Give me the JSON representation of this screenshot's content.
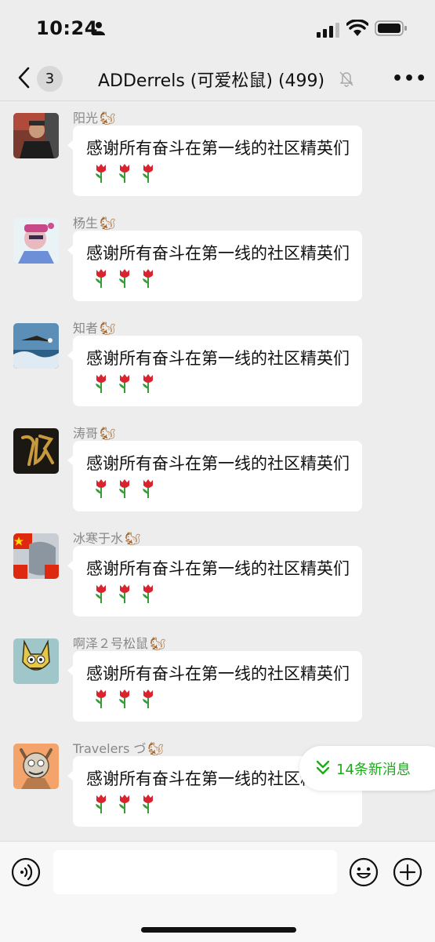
{
  "status": {
    "time": "10:24"
  },
  "nav": {
    "back_count": "3",
    "title": "ADDerrels (可爱松鼠) (499)"
  },
  "messages": [
    {
      "sender": "阳光",
      "text": "感谢所有奋斗在第一线的社区精英们",
      "avatar": "photo-man"
    },
    {
      "sender": "杨生",
      "text": "感谢所有奋斗在第一线的社区精英们",
      "avatar": "cartoon-pink"
    },
    {
      "sender": "知者",
      "text": "感谢所有奋斗在第一线的社区精英们",
      "avatar": "eagle-sea"
    },
    {
      "sender": "涛哥",
      "text": "感谢所有奋斗在第一线的社区精英们",
      "avatar": "gold-calligraphy"
    },
    {
      "sender": "冰寒于水",
      "text": "感谢所有奋斗在第一线的社区精英们",
      "avatar": "china-flag"
    },
    {
      "sender": "啊泽２号松鼠",
      "text": "感谢所有奋斗在第一线的社区精英们",
      "avatar": "cartoon-yellow-cat"
    },
    {
      "sender": "Travelers づ",
      "text": "感谢所有奋斗在第一线的社区精英们",
      "avatar": "cartoon-orange"
    }
  ],
  "new_messages": {
    "label": "14条新消息"
  },
  "colors": {
    "accent": "#1aad19",
    "background": "#ededed",
    "bubble": "#ffffff"
  }
}
